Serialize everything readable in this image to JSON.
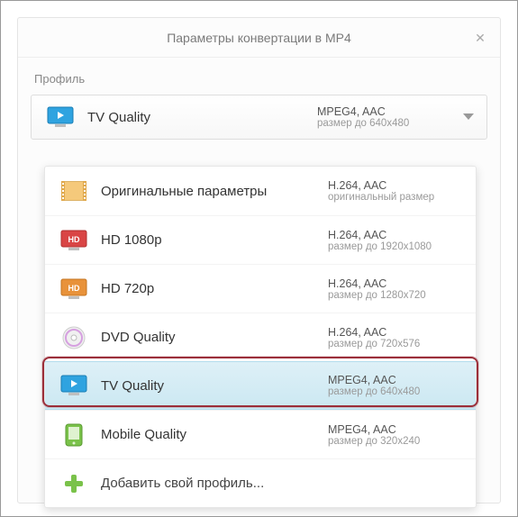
{
  "dialog": {
    "title": "Параметры конвертации в MP4",
    "close_glyph": "✕"
  },
  "profile": {
    "label": "Профиль",
    "selected": {
      "title": "TV Quality",
      "codec": "MPEG4, AAC",
      "size": "размер до 640x480"
    }
  },
  "options": [
    {
      "icon": "film",
      "title": "Оригинальные параметры",
      "codec": "H.264, AAC",
      "size": "оригинальный размер"
    },
    {
      "icon": "hd-red",
      "title": "HD 1080p",
      "codec": "H.264, AAC",
      "size": "размер до 1920x1080"
    },
    {
      "icon": "hd-orange",
      "title": "HD 720p",
      "codec": "H.264, AAC",
      "size": "размер до 1280x720"
    },
    {
      "icon": "dvd",
      "title": "DVD Quality",
      "codec": "H.264, AAC",
      "size": "размер до 720x576"
    },
    {
      "icon": "tv",
      "title": "TV Quality",
      "codec": "MPEG4, AAC",
      "size": "размер до 640x480",
      "selected": true
    },
    {
      "icon": "mobile",
      "title": "Mobile Quality",
      "codec": "MPEG4, AAC",
      "size": "размер до 320x240"
    },
    {
      "icon": "plus",
      "title": "Добавить свой профиль...",
      "add": true
    }
  ]
}
